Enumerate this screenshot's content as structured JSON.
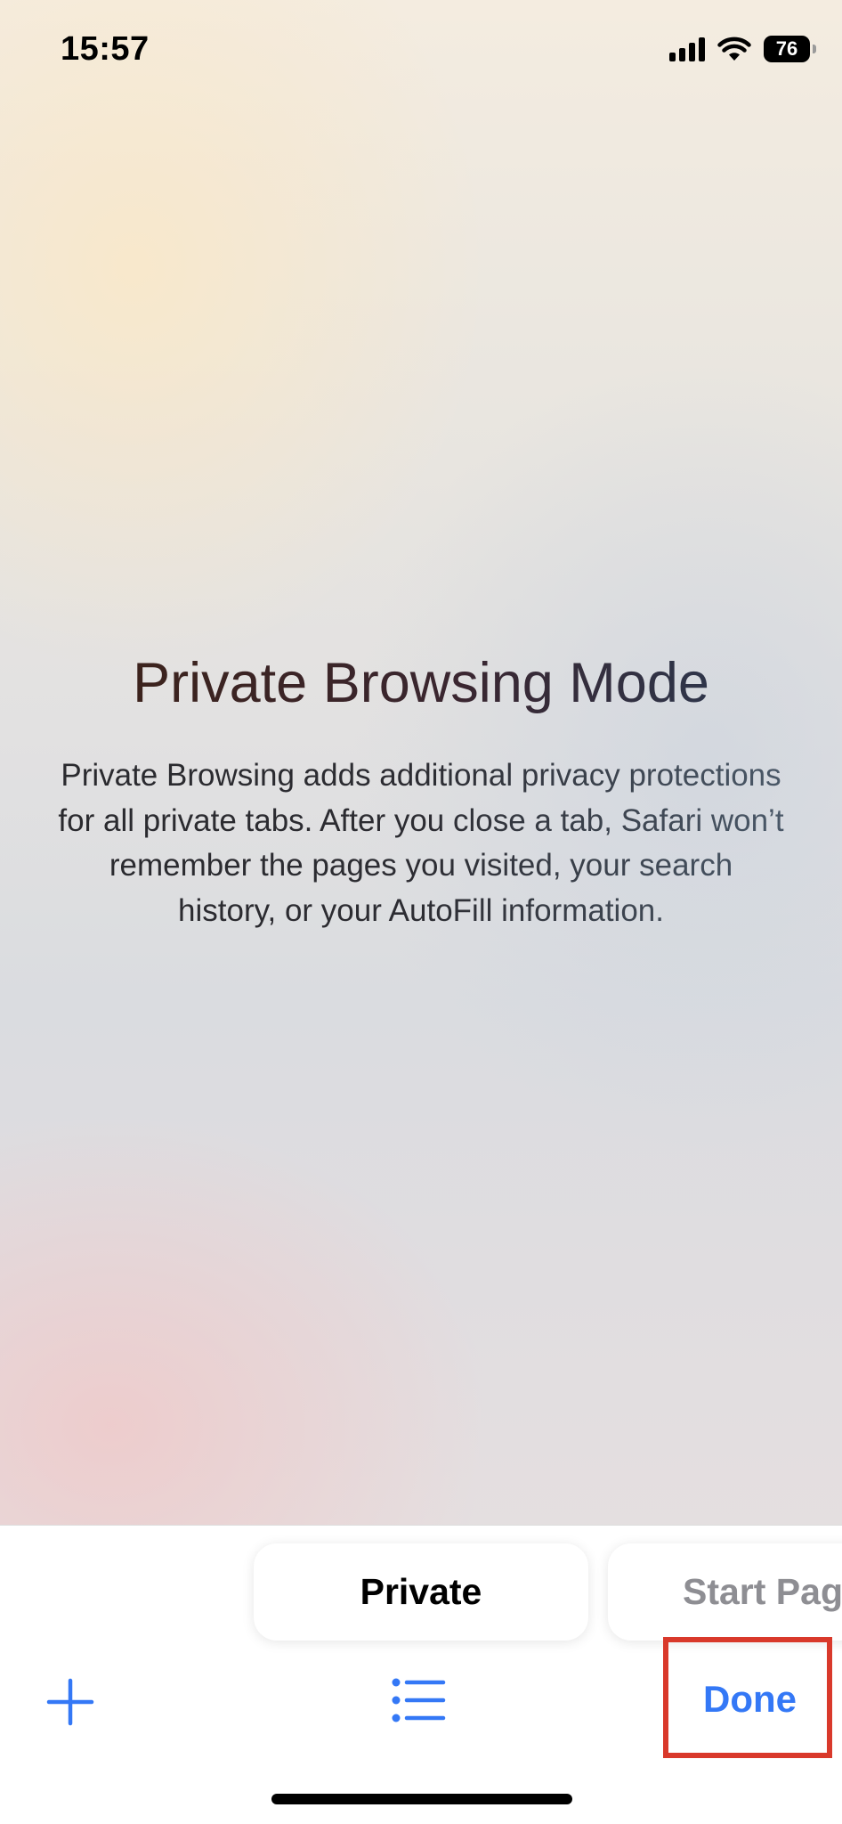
{
  "status_bar": {
    "time": "15:57",
    "battery": "76",
    "icons": [
      "cellular-signal-icon",
      "wifi-icon",
      "battery-icon"
    ]
  },
  "private_mode": {
    "title": "Private Browsing Mode",
    "description": "Private Browsing adds additional privacy protections for all private tabs. After you close a tab, Safari won’t remember the pages you visited, your search history, or your AutoFill information."
  },
  "tab_groups": [
    {
      "label": "Private",
      "selected": true
    },
    {
      "label": "Start Page",
      "selected": false
    }
  ],
  "toolbar": {
    "new_tab_icon": "plus-icon",
    "tab_groups_icon": "list-icon",
    "done_label": "Done"
  },
  "colors": {
    "accent": "#3478f6",
    "highlight": "#d9392b"
  }
}
